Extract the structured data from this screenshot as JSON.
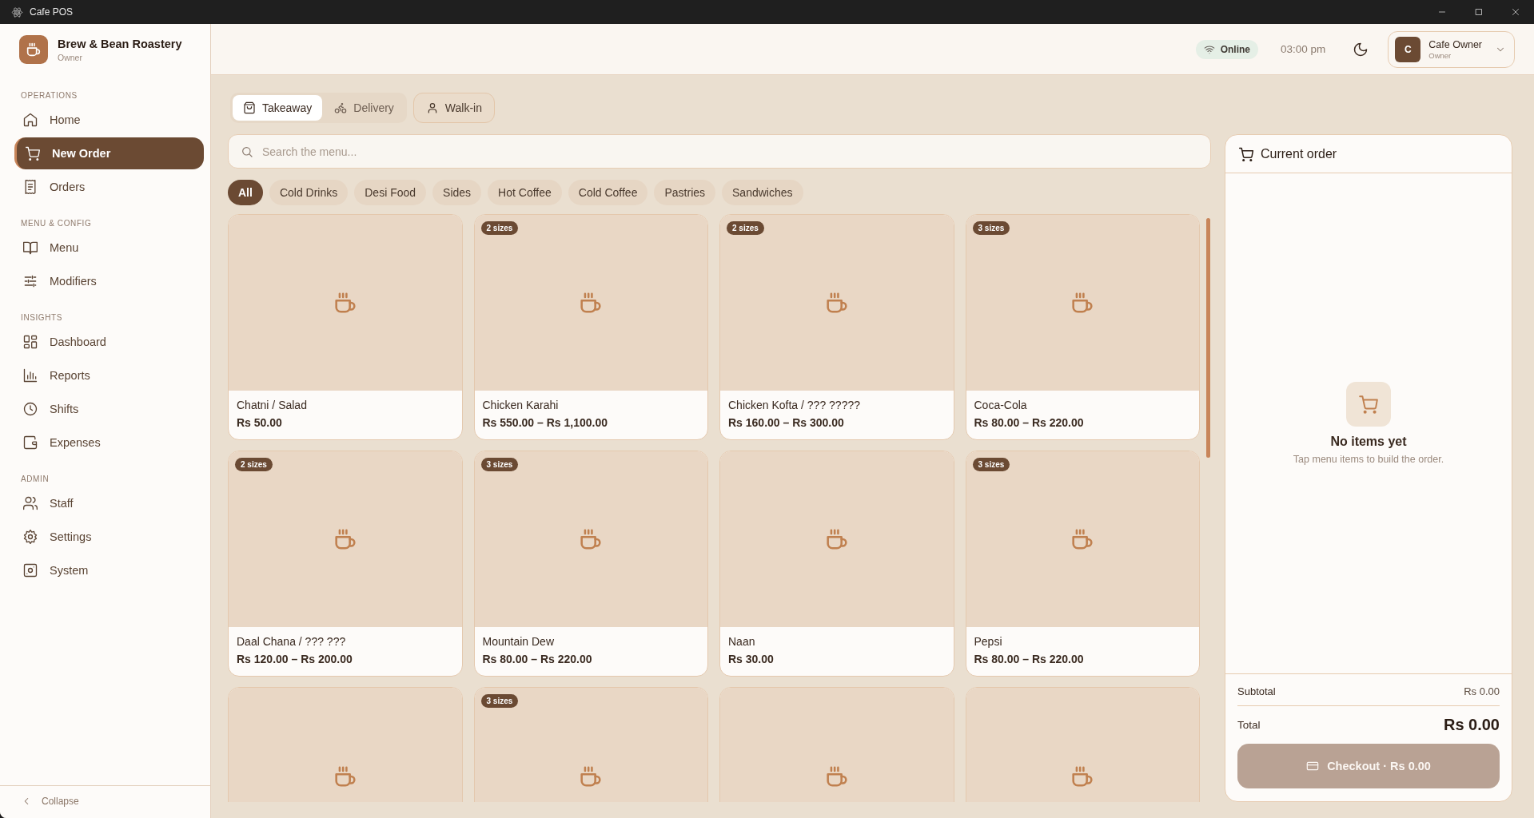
{
  "window": {
    "title": "Cafe POS"
  },
  "sidebar": {
    "brand": {
      "name": "Brew & Bean Roastery",
      "role": "Owner"
    },
    "sections": [
      {
        "label": "OPERATIONS",
        "items": [
          {
            "label": "Home",
            "selected": false
          },
          {
            "label": "New Order",
            "selected": true
          },
          {
            "label": "Orders",
            "selected": false
          }
        ]
      },
      {
        "label": "MENU & CONFIG",
        "items": [
          {
            "label": "Menu",
            "selected": false
          },
          {
            "label": "Modifiers",
            "selected": false
          }
        ]
      },
      {
        "label": "INSIGHTS",
        "items": [
          {
            "label": "Dashboard",
            "selected": false
          },
          {
            "label": "Reports",
            "selected": false
          },
          {
            "label": "Shifts",
            "selected": false
          },
          {
            "label": "Expenses",
            "selected": false
          }
        ]
      },
      {
        "label": "ADMIN",
        "items": [
          {
            "label": "Staff",
            "selected": false
          },
          {
            "label": "Settings",
            "selected": false
          },
          {
            "label": "System",
            "selected": false
          }
        ]
      }
    ],
    "collapse": "Collapse"
  },
  "topbar": {
    "connection": {
      "label": "Online",
      "online": true
    },
    "time": "03:00 pm",
    "user": {
      "initial": "C",
      "name": "Cafe Owner",
      "role": "Owner"
    }
  },
  "order_types": [
    {
      "label": "Takeaway",
      "selected": true
    },
    {
      "label": "Delivery",
      "selected": false
    }
  ],
  "customer_button": {
    "label": "Walk-in"
  },
  "search": {
    "placeholder": "Search the menu..."
  },
  "categories": [
    {
      "label": "All",
      "selected": true
    },
    {
      "label": "Cold Drinks",
      "selected": false
    },
    {
      "label": "Desi Food",
      "selected": false
    },
    {
      "label": "Sides",
      "selected": false
    },
    {
      "label": "Hot Coffee",
      "selected": false
    },
    {
      "label": "Cold Coffee",
      "selected": false
    },
    {
      "label": "Pastries",
      "selected": false
    },
    {
      "label": "Sandwiches",
      "selected": false
    }
  ],
  "menu_items": [
    {
      "kind": "full",
      "name": "Chatni / Salad",
      "price": "Rs 50.00"
    },
    {
      "kind": "full",
      "badge": "2 sizes",
      "name": "Chicken Karahi",
      "price": "Rs 550.00 – Rs 1,100.00"
    },
    {
      "kind": "full",
      "badge": "2 sizes",
      "name": "Chicken Kofta / ??? ?????",
      "price": "Rs 160.00 – Rs 300.00"
    },
    {
      "kind": "full",
      "badge": "3 sizes",
      "name": "Coca-Cola",
      "price": "Rs 80.00 – Rs 220.00"
    },
    {
      "kind": "full",
      "badge": "2 sizes",
      "name": "Daal Chana / ??? ???",
      "price": "Rs 120.00 – Rs 200.00"
    },
    {
      "kind": "full",
      "badge": "3 sizes",
      "name": "Mountain Dew",
      "price": "Rs 80.00 – Rs 220.00"
    },
    {
      "kind": "full",
      "name": "Naan",
      "price": "Rs 30.00"
    },
    {
      "kind": "full",
      "badge": "3 sizes",
      "name": "Pepsi",
      "price": "Rs 80.00 – Rs 220.00"
    },
    {
      "kind": "partial"
    },
    {
      "kind": "partial",
      "badge": "3 sizes"
    },
    {
      "kind": "partial"
    },
    {
      "kind": "partial"
    }
  ],
  "order": {
    "title": "Current order",
    "empty": {
      "title": "No items yet",
      "hint": "Tap menu items to build the order."
    },
    "subtotal": {
      "label": "Subtotal",
      "value": "Rs 0.00"
    },
    "total": {
      "label": "Total",
      "value": "Rs 0.00"
    },
    "checkout": {
      "label": "Checkout · Rs 0.00",
      "disabled": true
    }
  }
}
